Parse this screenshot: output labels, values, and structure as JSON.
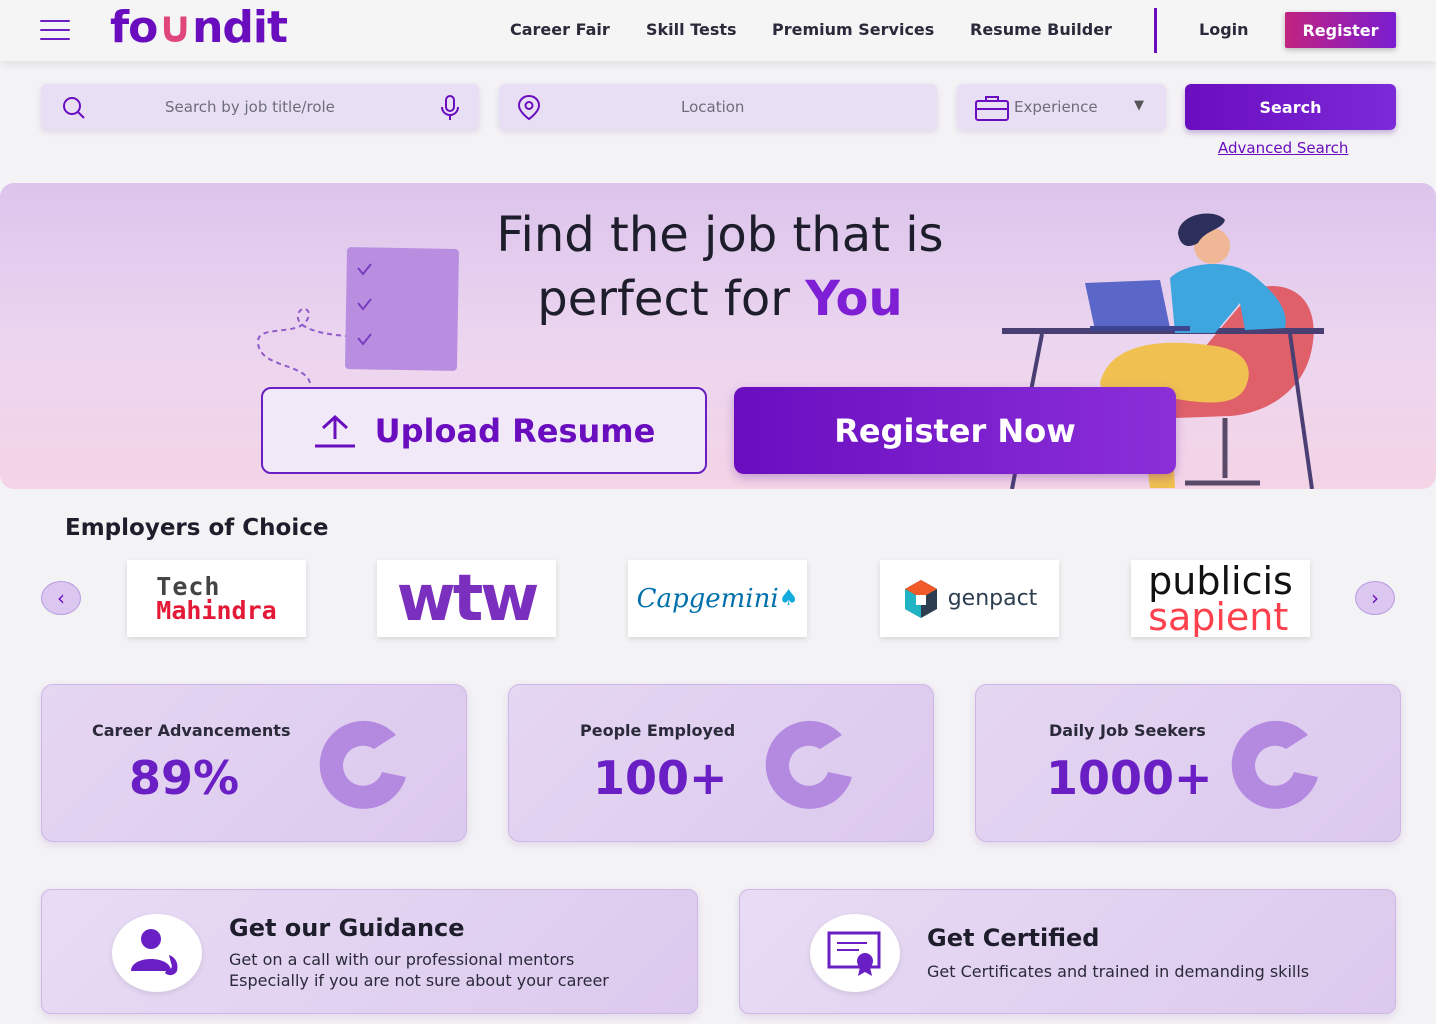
{
  "header": {
    "logo_text_a": "fo",
    "logo_text_u": "∪",
    "logo_text_b": "ndit",
    "nav": {
      "career_fair": "Career Fair",
      "skill_tests": "Skill Tests",
      "premium_services": "Premium Services",
      "resume_builder": "Resume Builder",
      "login": "Login",
      "register": "Register"
    }
  },
  "search": {
    "job_placeholder": "Search by job title/role",
    "location_placeholder": "Location",
    "experience_placeholder": "Experience",
    "search_label": "Search",
    "advanced_label": "Advanced Search"
  },
  "hero": {
    "title_line1": "Find the job that is",
    "title_line2_pre": "perfect for ",
    "title_line2_hl": "You",
    "upload_label": "Upload Resume",
    "register_label": "Register Now"
  },
  "employers": {
    "title": "Employers of Choice",
    "logos": {
      "tech_mahindra_a": "Tech",
      "tech_mahindra_b": "Mahindra",
      "wtw": "wtw",
      "capgemini": "Capgemini",
      "genpact": "genpact",
      "publicis_a": "publicis",
      "publicis_b": "sapient"
    }
  },
  "stats": [
    {
      "label": "Career Advancements",
      "value": "89%"
    },
    {
      "label": "People Employed",
      "value": "100+"
    },
    {
      "label": "Daily Job Seekers",
      "value": "1000+"
    }
  ],
  "guidance": {
    "title": "Get our Guidance",
    "line1": "Get on a call with our professional mentors",
    "line2": "Especially if you are not sure about your career"
  },
  "certified": {
    "title": "Get Certified",
    "line1": "Get Certificates and trained in demanding skills"
  },
  "colors": {
    "brand": "#6a0dbf",
    "accent_pink": "#c2237f",
    "card_bg": "#e5d6f2"
  }
}
